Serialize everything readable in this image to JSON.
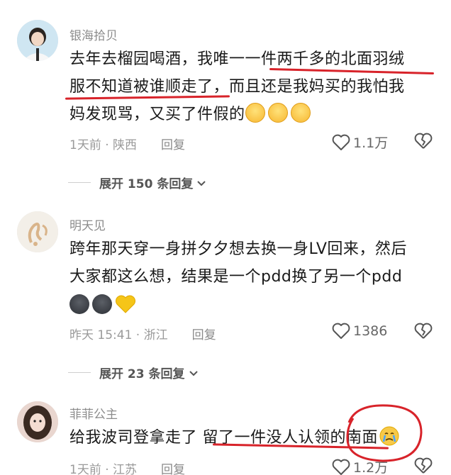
{
  "comments": [
    {
      "username": "银海拾贝",
      "line1": "去年去榴园喝酒，我唯一一件两千多的北面羽绒",
      "line2": "服不知道被谁顺走了，而且还是我妈买的我怕我",
      "line3": "妈发现骂，又买了件假的",
      "time_location": "1天前 · 陕西",
      "reply": "回复",
      "likes": "1.1万",
      "expand": "展开 150 条回复"
    },
    {
      "username": "明天见",
      "line1": "跨年那天穿一身拼夕夕想去换一身LV回来，然后",
      "line2": "大家都这么想，结果是一个pdd换了另一个pdd",
      "time_location": "昨天 15:41 · 浙江",
      "reply": "回复",
      "likes": "1386",
      "expand": "展开 23 条回复"
    },
    {
      "username": "菲菲公主",
      "line1": "给我波司登拿走了  留了一件没人认领的南面",
      "time_location": "1天前 · 江苏",
      "reply": "回复",
      "likes": "1.2万"
    }
  ],
  "colors": {
    "annotation_red": "#d8232a",
    "muted_text": "#9a9a9a"
  },
  "icons": [
    "heart-outline-icon",
    "broken-heart-icon",
    "chevron-down-icon",
    "smile-emoji-icon",
    "dark-face-emoji-icon",
    "yellow-heart-emoji-icon",
    "crying-emoji-icon"
  ]
}
